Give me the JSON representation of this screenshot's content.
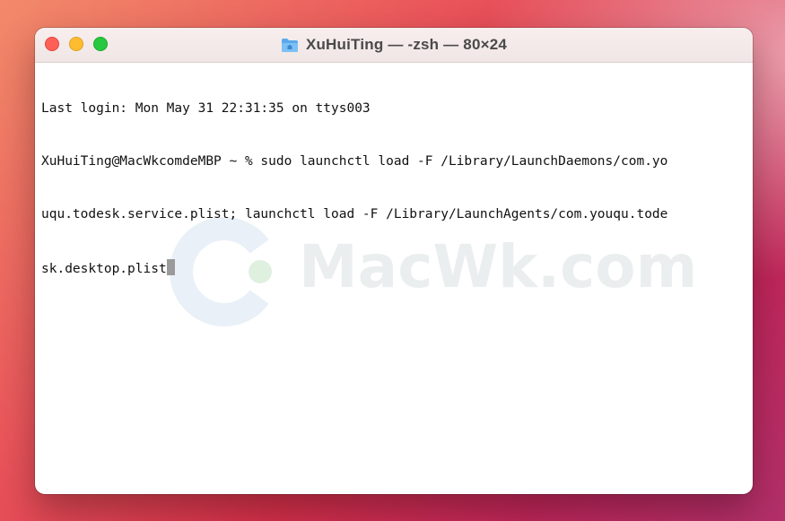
{
  "window": {
    "title": "XuHuiTing — -zsh — 80×24",
    "title_icon": "folder-icon",
    "buttons": [
      "close",
      "minimize",
      "zoom"
    ]
  },
  "terminal": {
    "lines": [
      "Last login: Mon May 31 22:31:35 on ttys003",
      "XuHuiTing@MacWkcomdeMBP ~ % sudo launchctl load -F /Library/LaunchDaemons/com.yo",
      "uqu.todesk.service.plist; launchctl load -F /Library/LaunchAgents/com.youqu.tode",
      "sk.desktop.plist"
    ],
    "cursor": "block"
  },
  "watermark": {
    "text": "MacWk.com"
  },
  "colors": {
    "close": "#fe5f57",
    "minimize": "#febc2e",
    "zoom": "#28c840",
    "watermark_logo": "#e6eef6",
    "watermark_dot": "#dcefdc"
  }
}
